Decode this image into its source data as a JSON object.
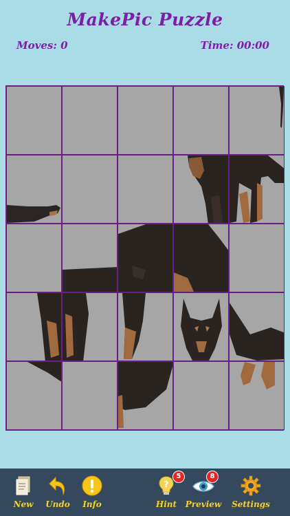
{
  "title": "MakePic Puzzle",
  "stats": {
    "moves": "Moves:  0",
    "time": "Time: 00:00"
  },
  "colors": {
    "accent": "#7a1fa8",
    "toolbar": "#34495d",
    "tool_label": "#f5d130",
    "board": "#a6a6a6",
    "badge": "#e62424"
  },
  "toolbar": {
    "new": {
      "label": "New",
      "icon": "new-document-icon"
    },
    "undo": {
      "label": "Undo",
      "icon": "undo-arrow-icon"
    },
    "info": {
      "label": "Info",
      "icon": "info-exclamation-icon"
    },
    "hint": {
      "label": "Hint",
      "icon": "lightbulb-icon",
      "badge": "5"
    },
    "preview": {
      "label": "Preview",
      "icon": "eye-icon",
      "badge": "8"
    },
    "settings": {
      "label": "Settings",
      "icon": "gear-icon"
    }
  }
}
